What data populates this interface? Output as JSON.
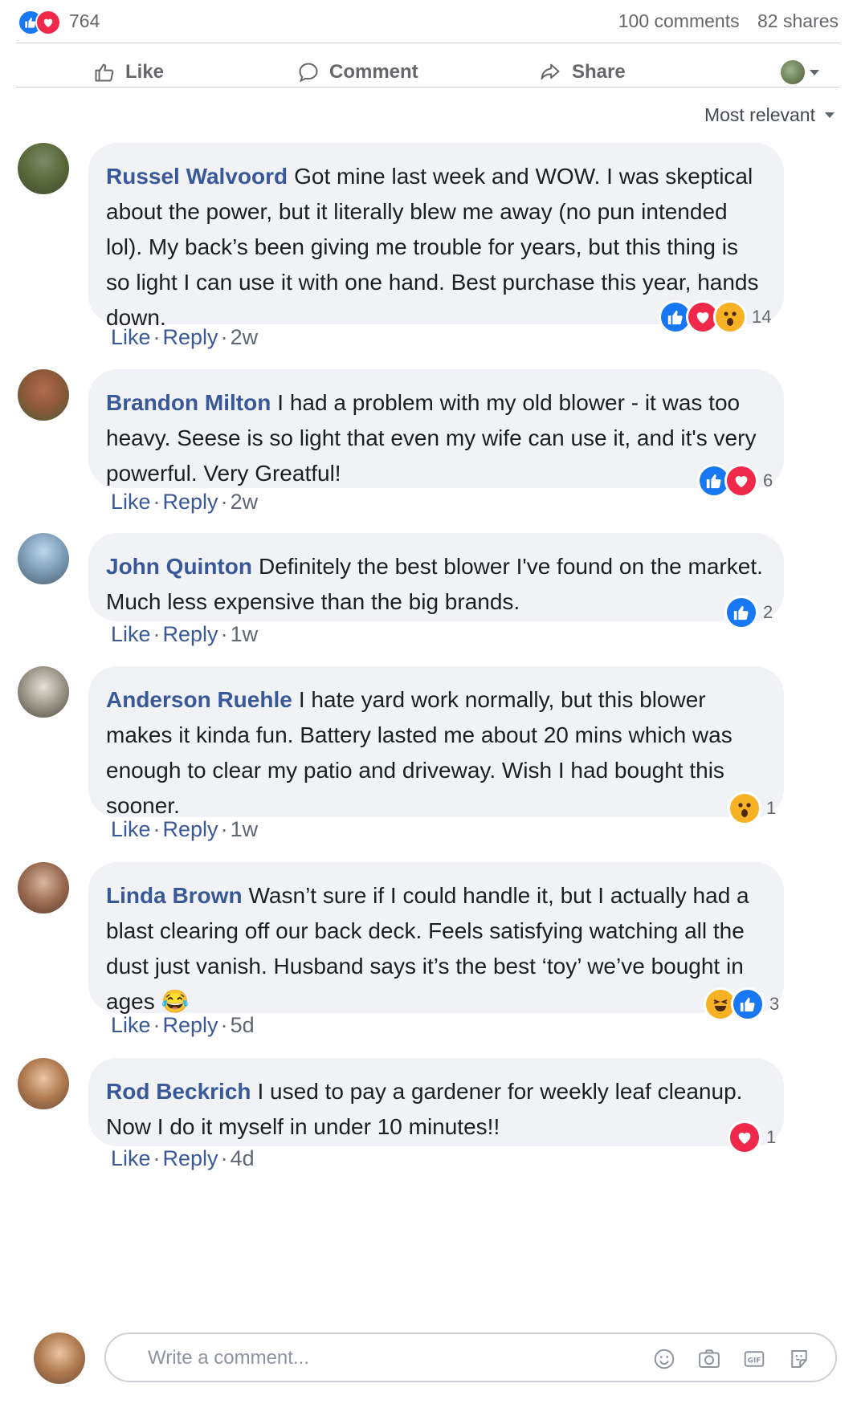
{
  "post_stats": {
    "reaction_count": "764",
    "comments_count": "100 comments",
    "shares_count": "82 shares",
    "reactions": [
      "like-icon",
      "love-icon"
    ]
  },
  "actions": {
    "like": "Like",
    "comment": "Comment",
    "share": "Share"
  },
  "sort": {
    "label": "Most relevant"
  },
  "comments": [
    {
      "author": "Russel Walvoord",
      "text": "Got mine last week and WOW. I was skeptical about the power, but it literally blew me away (no pun intended lol). My back’s been giving me trouble for years, but this thing is so light I can use it with one hand. Best purchase this year, hands down.",
      "like": "Like",
      "reply": "Reply",
      "time": "2w",
      "reaction_count": "14",
      "reactions": [
        "like-icon",
        "love-icon",
        "wow-icon"
      ]
    },
    {
      "author": "Brandon Milton",
      "text": "I had a problem with my old blower - it was too heavy. Seese is so light that even my wife can use it, and it's very powerful. Very Greatful!",
      "like": "Like",
      "reply": "Reply",
      "time": "2w",
      "reaction_count": "6",
      "reactions": [
        "like-icon",
        "love-icon"
      ]
    },
    {
      "author": "John Quinton",
      "text": "Definitely the best blower I've found on the market. Much less expensive than the big brands.",
      "like": "Like",
      "reply": "Reply",
      "time": "1w",
      "reaction_count": "2",
      "reactions": [
        "like-icon"
      ]
    },
    {
      "author": "Anderson Ruehle",
      "text": "I hate yard work normally, but this blower makes it kinda fun. Battery lasted me about 20 mins which was enough to clear my patio and driveway. Wish I had bought this sooner.",
      "like": "Like",
      "reply": "Reply",
      "time": "1w",
      "reaction_count": "1",
      "reactions": [
        "wow-icon"
      ]
    },
    {
      "author": "Linda Brown",
      "text": "Wasn’t sure if I could handle it, but I actually had a blast clearing off our back deck. Feels satisfying watching all the dust just vanish. Husband says it’s the best ‘toy’ we’ve bought in ages 😂",
      "like": "Like",
      "reply": "Reply",
      "time": "5d",
      "reaction_count": "3",
      "reactions": [
        "haha-icon",
        "like-icon"
      ]
    },
    {
      "author": "Rod Beckrich",
      "text": "I used to pay a gardener for weekly leaf cleanup. Now I do it myself in under 10 minutes!!",
      "like": "Like",
      "reply": "Reply",
      "time": "4d",
      "reaction_count": "1",
      "reactions": [
        "love-icon"
      ]
    }
  ],
  "composer": {
    "placeholder": "Write a comment...",
    "tools": [
      "emoji-icon",
      "camera-icon",
      "gif-icon",
      "sticker-icon"
    ]
  },
  "colors": {
    "link": "#385898",
    "like": "#1877f2",
    "love": "#f0284a",
    "wow": "#f7b125",
    "bubble": "#f0f2f5"
  }
}
